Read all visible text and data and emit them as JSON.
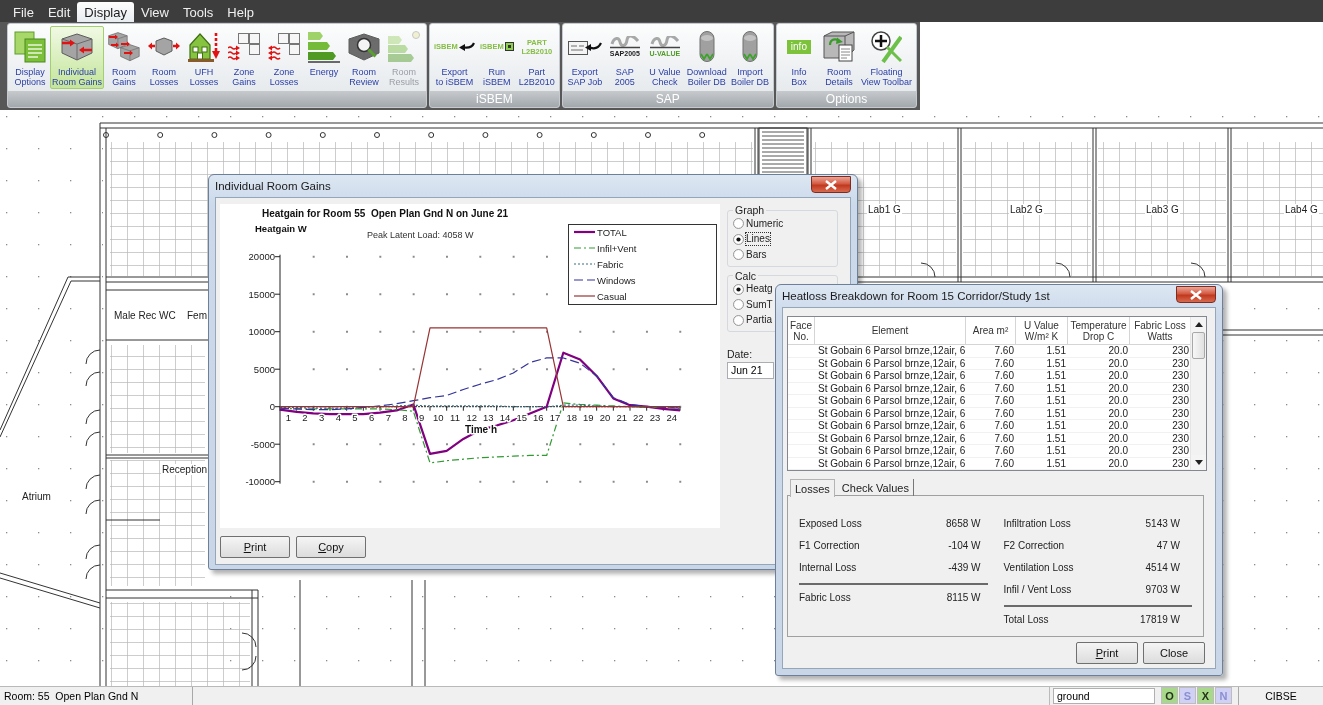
{
  "menu": [
    {
      "label": "File",
      "selected": false
    },
    {
      "label": "Edit",
      "selected": false
    },
    {
      "label": "Display",
      "selected": true
    },
    {
      "label": "View",
      "selected": false
    },
    {
      "label": "Tools",
      "selected": false
    },
    {
      "label": "Help",
      "selected": false
    }
  ],
  "ribbon": {
    "groups": [
      {
        "tools": [
          {
            "label": [
              "Display",
              "Options"
            ],
            "selected": false,
            "disabled": false
          },
          {
            "label": [
              "Individual",
              "Room Gains"
            ],
            "selected": true,
            "disabled": false
          },
          {
            "label": [
              "Room",
              "Gains"
            ],
            "selected": false,
            "disabled": false
          },
          {
            "label": [
              "Room",
              "Losses"
            ],
            "selected": false,
            "disabled": false
          },
          {
            "label": [
              "UFH",
              "Losses"
            ],
            "selected": false,
            "disabled": false
          },
          {
            "label": [
              "Zone",
              "Gains"
            ],
            "selected": false,
            "disabled": false
          },
          {
            "label": [
              "Zone",
              "Losses"
            ],
            "selected": false,
            "disabled": false
          },
          {
            "label": [
              "Energy"
            ],
            "selected": false,
            "disabled": false
          },
          {
            "label": [
              "Room",
              "Review"
            ],
            "selected": false,
            "disabled": false
          },
          {
            "label": [
              "Room",
              "Results"
            ],
            "selected": false,
            "disabled": true
          }
        ]
      },
      {
        "title": "iSBEM",
        "tools": [
          {
            "label": [
              "Export",
              "to iSBEM"
            ],
            "logo": [
              "iSBEM"
            ],
            "selected": false,
            "disabled": false
          },
          {
            "label": [
              "Run",
              "iSBEM"
            ],
            "logo": [
              "iSBEM"
            ],
            "selected": false,
            "disabled": false
          },
          {
            "label": [
              "Part",
              "L2B2010"
            ],
            "logo": [
              "PART",
              "L2B2010"
            ],
            "selected": false,
            "disabled": false
          }
        ]
      },
      {
        "title": "SAP",
        "tools": [
          {
            "label": [
              "Export",
              "SAP Job"
            ],
            "selected": false,
            "disabled": false
          },
          {
            "label": [
              "SAP",
              "2005"
            ],
            "logo": [
              "SAP2005"
            ],
            "selected": false,
            "disabled": false
          },
          {
            "label": [
              "U Value",
              "Check"
            ],
            "logo": [
              "U-VALUE"
            ],
            "selected": false,
            "disabled": false
          },
          {
            "label": [
              "Download",
              "Boiler DB"
            ],
            "selected": false,
            "disabled": false
          },
          {
            "label": [
              "Import",
              "Boiler DB"
            ],
            "selected": false,
            "disabled": false
          }
        ]
      },
      {
        "title": "Options",
        "tools": [
          {
            "label": [
              "Info",
              "Box"
            ],
            "logo": [
              "info"
            ],
            "selected": false,
            "disabled": false
          },
          {
            "label": [
              "Room",
              "Details"
            ],
            "selected": false,
            "disabled": false
          },
          {
            "label": [
              "Floating",
              "View Toolbar"
            ],
            "selected": false,
            "disabled": false
          }
        ]
      }
    ]
  },
  "floor_plan": {
    "rooms": [
      {
        "label": "Lab1 G"
      },
      {
        "label": "Lab2 G"
      },
      {
        "label": "Lab3 G"
      },
      {
        "label": "Lab4 G"
      },
      {
        "label": "Male Rec WC"
      },
      {
        "label": "Fem"
      },
      {
        "label": "Reception"
      },
      {
        "label": "Atrium"
      }
    ]
  },
  "gains_dialog": {
    "title": "Individual Room Gains",
    "chart_data": {
      "type": "line",
      "title": "Heatgain for Room 55  Open Plan Gnd N on June 21",
      "xlabel": "Time h",
      "ylabel": "Heatgain W",
      "x": [
        0,
        1,
        2,
        3,
        4,
        5,
        6,
        7,
        8,
        9,
        10,
        11,
        12,
        13,
        14,
        15,
        16,
        17,
        18,
        19,
        20,
        21,
        22,
        23,
        24
      ],
      "xlim": [
        0,
        24
      ],
      "ylim": [
        -10000,
        20000
      ],
      "xticks": [
        {
          "value": 0.5,
          "label": "1"
        },
        {
          "value": 1.5,
          "label": "2"
        },
        {
          "value": 2.5,
          "label": "3"
        },
        {
          "value": 3.5,
          "label": "4"
        },
        {
          "value": 4.5,
          "label": "5"
        },
        {
          "value": 5.5,
          "label": "6"
        },
        {
          "value": 6.5,
          "label": "7"
        },
        {
          "value": 7.5,
          "label": "8"
        },
        {
          "value": 8.5,
          "label": "9"
        },
        {
          "value": 9.5,
          "label": "10"
        },
        {
          "value": 10.5,
          "label": "11"
        },
        {
          "value": 11.5,
          "label": "12"
        },
        {
          "value": 12.5,
          "label": "13"
        },
        {
          "value": 13.5,
          "label": "14"
        },
        {
          "value": 14.5,
          "label": "15"
        },
        {
          "value": 15.5,
          "label": "16"
        },
        {
          "value": 16.5,
          "label": "17"
        },
        {
          "value": 17.5,
          "label": "18"
        },
        {
          "value": 18.5,
          "label": "19"
        },
        {
          "value": 19.5,
          "label": "20"
        },
        {
          "value": 20.5,
          "label": "21"
        },
        {
          "value": 21.5,
          "label": "22"
        },
        {
          "value": 22.5,
          "label": "23"
        },
        {
          "value": 23.5,
          "label": "24"
        }
      ],
      "yticks": [
        20000,
        15000,
        10000,
        5000,
        0,
        -5000,
        -10000
      ],
      "legend": "upper right",
      "series": [
        {
          "name": "TOTAL",
          "color": "#800080",
          "line_style": "solid",
          "values": [
            -400,
            -700,
            -900,
            -1000,
            -1000,
            -1000,
            -800,
            -500,
            300,
            -6300,
            -5900,
            -4300,
            -3100,
            -2500,
            -1800,
            -900,
            0,
            7200,
            6300,
            4100,
            1100,
            200,
            0,
            -300,
            -500
          ]
        },
        {
          "name": "Infil+Vent",
          "color": "#339933",
          "line_style": "dash-dot",
          "values": [
            -200,
            -300,
            -300,
            -300,
            -300,
            -300,
            -300,
            -400,
            -600,
            -7500,
            -7200,
            -7000,
            -6800,
            -6700,
            -6600,
            -6500,
            -6500,
            500,
            300,
            200,
            100,
            0,
            -100,
            -100,
            -200
          ]
        },
        {
          "name": "Fabric",
          "color": "#3a6f80",
          "line_style": "dotted",
          "values": [
            -100,
            -100,
            -200,
            -200,
            -200,
            -100,
            0,
            100,
            200,
            100,
            100,
            100,
            100,
            100,
            0,
            0,
            0,
            200,
            200,
            100,
            0,
            0,
            -100,
            -100,
            -100
          ]
        },
        {
          "name": "Windows",
          "color": "#333399",
          "line_style": "dashed",
          "values": [
            -200,
            -300,
            -400,
            -400,
            -300,
            -100,
            100,
            400,
            800,
            1200,
            1500,
            2300,
            3000,
            3600,
            4500,
            5900,
            6500,
            6500,
            5800,
            4100,
            1200,
            300,
            0,
            -100,
            -200
          ]
        },
        {
          "name": "Casual",
          "color": "#993333",
          "line_style": "solid",
          "values": [
            0,
            0,
            0,
            0,
            0,
            0,
            0,
            0,
            0,
            10500,
            10500,
            10500,
            10500,
            10500,
            10500,
            10500,
            10500,
            0,
            0,
            0,
            0,
            0,
            0,
            0,
            0
          ]
        }
      ],
      "annotations": [
        {
          "text": "Peak Latent Load: 4058 W"
        }
      ]
    },
    "graph_group": {
      "title": "Graph",
      "options": [
        {
          "label": "Numeric",
          "selected": false,
          "focused": false
        },
        {
          "label": "Lines",
          "selected": true,
          "focused": true
        },
        {
          "label": "Bars",
          "selected": false,
          "focused": false
        }
      ]
    },
    "calc_group": {
      "title": "Calc",
      "options": [
        {
          "label": "Heatg",
          "selected": true
        },
        {
          "label": "SumT",
          "selected": false
        },
        {
          "label": "Partia",
          "selected": false
        }
      ]
    },
    "date": {
      "label": "Date:",
      "value": "Jun 21"
    },
    "buttons": [
      {
        "label": "Print",
        "mnemonic": true
      },
      {
        "label": "Copy",
        "mnemonic": true
      }
    ]
  },
  "heatloss_dialog": {
    "title": "Heatloss Breakdown for Room 15 Corridor/Study 1st",
    "table": {
      "columns": [
        "Face No.",
        "Element",
        "Area m²",
        "U Value W/m² K",
        "Temperature Drop C",
        "Fabric Loss Watts"
      ],
      "rows": [
        {
          "element": "St Gobain 6 Parsol brnze,12air, 6",
          "area": "7.60",
          "u_value": "1.51",
          "temp_drop": "20.0",
          "fabric_loss": "230"
        },
        {
          "element": "St Gobain 6 Parsol brnze,12air, 6",
          "area": "7.60",
          "u_value": "1.51",
          "temp_drop": "20.0",
          "fabric_loss": "230"
        },
        {
          "element": "St Gobain 6 Parsol brnze,12air, 6",
          "area": "7.60",
          "u_value": "1.51",
          "temp_drop": "20.0",
          "fabric_loss": "230"
        },
        {
          "element": "St Gobain 6 Parsol brnze,12air, 6",
          "area": "7.60",
          "u_value": "1.51",
          "temp_drop": "20.0",
          "fabric_loss": "230"
        },
        {
          "element": "St Gobain 6 Parsol brnze,12air, 6",
          "area": "7.60",
          "u_value": "1.51",
          "temp_drop": "20.0",
          "fabric_loss": "230"
        },
        {
          "element": "St Gobain 6 Parsol brnze,12air, 6",
          "area": "7.60",
          "u_value": "1.51",
          "temp_drop": "20.0",
          "fabric_loss": "230"
        },
        {
          "element": "St Gobain 6 Parsol brnze,12air, 6",
          "area": "7.60",
          "u_value": "1.51",
          "temp_drop": "20.0",
          "fabric_loss": "230"
        },
        {
          "element": "St Gobain 6 Parsol brnze,12air, 6",
          "area": "7.60",
          "u_value": "1.51",
          "temp_drop": "20.0",
          "fabric_loss": "230"
        },
        {
          "element": "St Gobain 6 Parsol brnze,12air, 6",
          "area": "7.60",
          "u_value": "1.51",
          "temp_drop": "20.0",
          "fabric_loss": "230"
        },
        {
          "element": "St Gobain 6 Parsol brnze,12air, 6",
          "area": "7.60",
          "u_value": "1.51",
          "temp_drop": "20.0",
          "fabric_loss": "230"
        }
      ]
    },
    "tabs": [
      {
        "label": "Losses",
        "selected": true
      },
      {
        "label": "Check Values",
        "selected": false
      }
    ],
    "losses": {
      "left": [
        {
          "label": "Exposed Loss",
          "value": "8658 W"
        },
        {
          "label": "F1 Correction",
          "value": "-104 W"
        },
        {
          "label": "Internal Loss",
          "value": "-439 W"
        }
      ],
      "left_total": {
        "label": "Fabric Loss",
        "value": "8115 W"
      },
      "right": [
        {
          "label": "Infiltration Loss",
          "value": "5143 W"
        },
        {
          "label": "F2 Correction",
          "value": "47 W"
        },
        {
          "label": "Ventilation Loss",
          "value": "4514 W"
        },
        {
          "label": "Infil / Vent Loss",
          "value": "9703 W"
        }
      ],
      "right_total": {
        "label": "Total Loss",
        "value": "17819 W"
      }
    },
    "buttons": [
      {
        "label": "Print",
        "mnemonic": true
      },
      {
        "label": "Close",
        "mnemonic": false
      }
    ]
  },
  "status_bar": {
    "room": "Room: 55  Open Plan Gnd N",
    "floor": "ground",
    "toggles": [
      {
        "label": "O",
        "on": true
      },
      {
        "label": "S",
        "on": false
      },
      {
        "label": "X",
        "on": true
      },
      {
        "label": "N",
        "on": false
      }
    ],
    "standard": "CIBSE"
  }
}
